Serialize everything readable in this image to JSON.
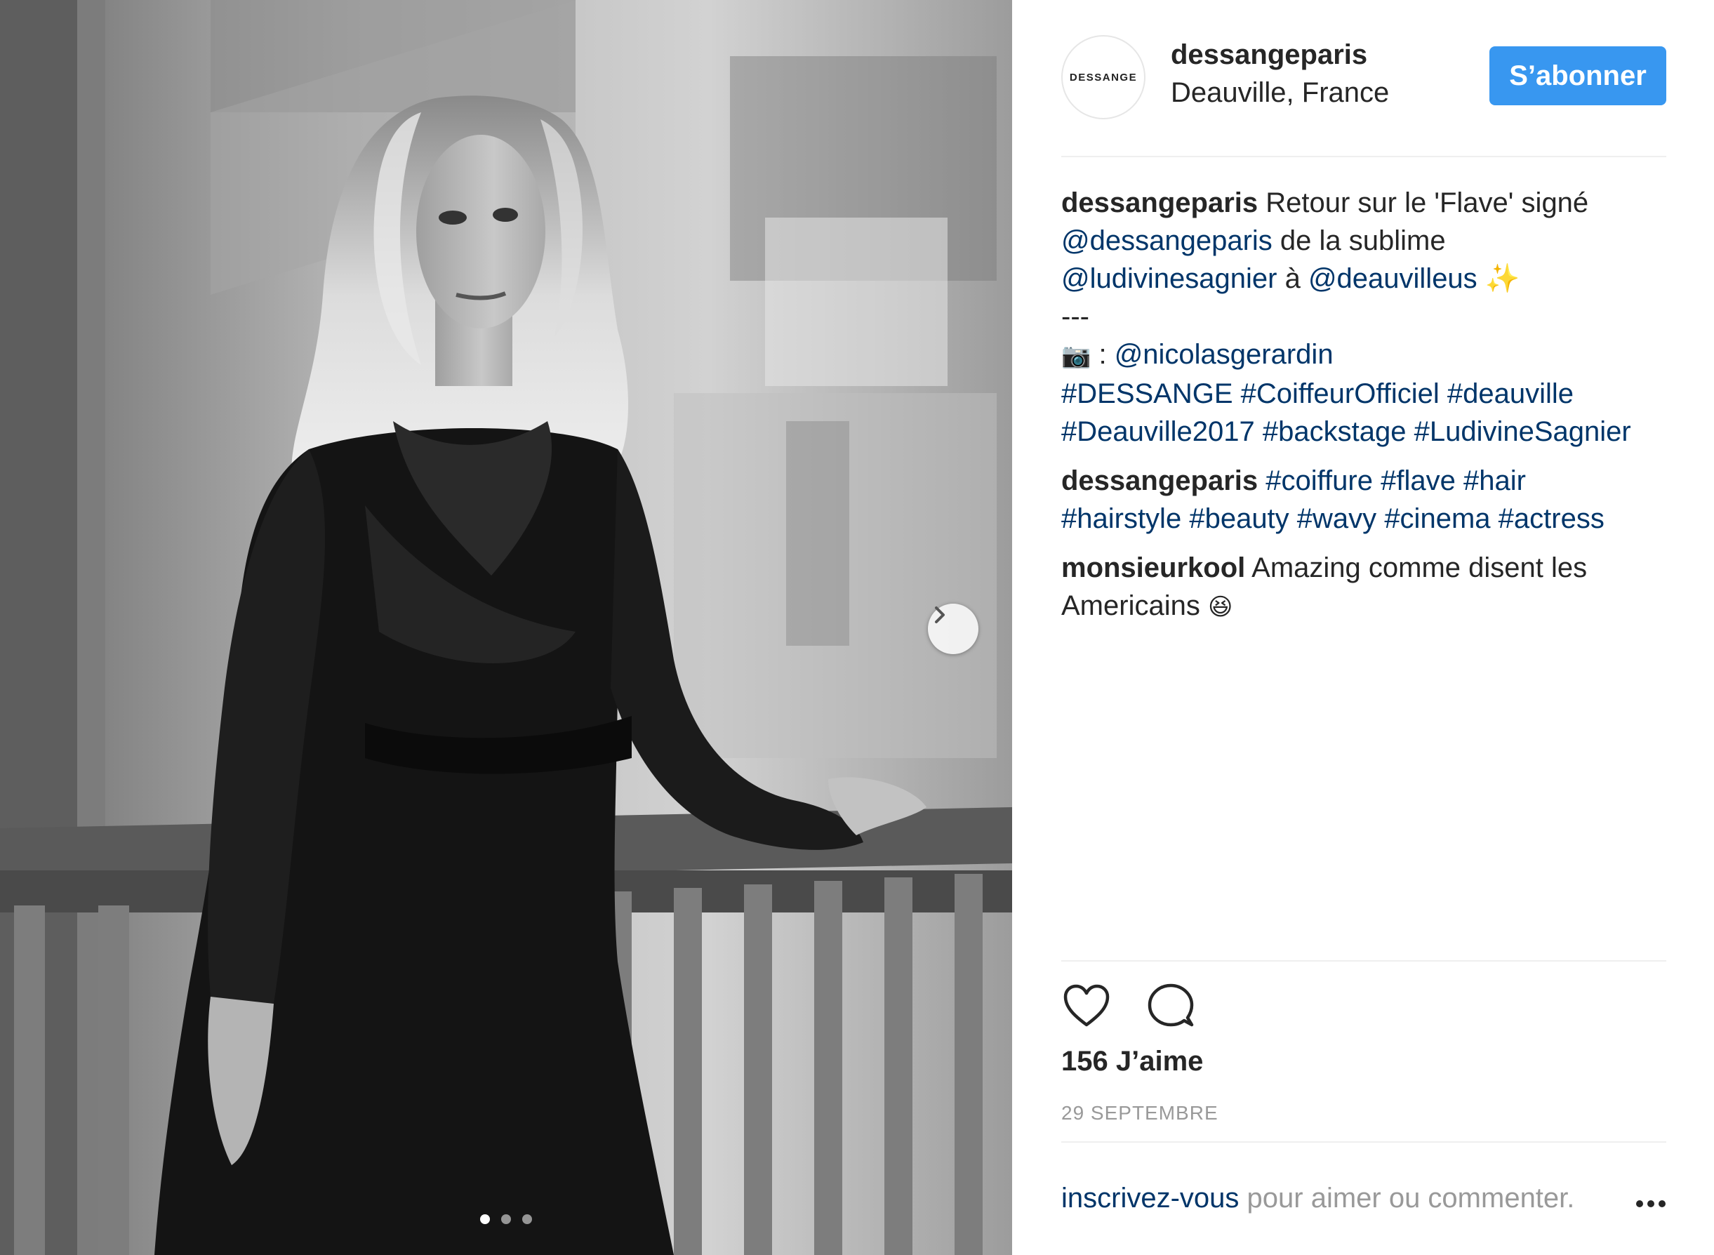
{
  "post": {
    "photo": {
      "description_icon": "photo-woman-black-dress-balcony",
      "carousel_dots": [
        true,
        false,
        false
      ],
      "next_icon": "chevron-right-icon"
    },
    "header": {
      "avatar_text": "DESSANGE",
      "username": "dessangeparis",
      "location": "Deauville, France",
      "follow_label": "S’abonner"
    },
    "caption": {
      "username": "dessangeparis",
      "text_1": " Retour sur le 'Flave' signé ",
      "mention_1": "@dessangeparis",
      "text_2": " de la sublime ",
      "mention_2": "@ludivinesagnier",
      "text_3": " à ",
      "mention_3": "@deauvilleus",
      "sparkles": "✨",
      "separator": "---",
      "camera_emoji": "📷",
      "credit_prefix": " : ",
      "credit_mention": "@nicolasgerardin",
      "hashtags": [
        "#DESSANGE",
        "#CoiffeurOfficiel",
        "#deauville",
        "#Deauville2017",
        "#backstage",
        "#LudivineSagnier"
      ]
    },
    "comments": [
      {
        "username": "dessangeparis",
        "hashtags": [
          "#coiffure",
          "#flave",
          "#hair",
          "#hairstyle",
          "#beauty",
          "#wavy",
          "#cinema",
          "#actress"
        ]
      },
      {
        "username": "monsieurkool",
        "text": " Amazing comme disent les Americains ",
        "emoji": "😆"
      }
    ],
    "actions": {
      "like_icon": "heart-icon",
      "comment_icon": "comment-bubble-icon"
    },
    "likes": "156 J’aime",
    "date": "29 SEPTEMBRE",
    "footer": {
      "link": "inscrivez-vous",
      "rest": " pour aimer ou commenter.",
      "more_icon": "more-options-icon"
    },
    "colors": {
      "follow_button": "#3897f0",
      "link": "#003569",
      "muted": "#999999",
      "text": "#262626"
    }
  }
}
